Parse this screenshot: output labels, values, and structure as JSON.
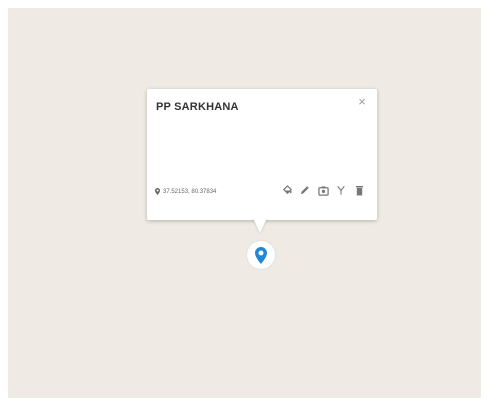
{
  "popup": {
    "title": "PP SARKHANA",
    "close_symbol": "×",
    "coordinates": "37.52153, 80.37834",
    "actions": [
      {
        "icon": "paint-bucket-icon"
      },
      {
        "icon": "pencil-icon"
      },
      {
        "icon": "camera-icon"
      },
      {
        "icon": "fork-icon"
      },
      {
        "icon": "trash-icon"
      }
    ]
  },
  "marker": {
    "icon": "location-pin-icon"
  },
  "colors": {
    "map_background": "#efebe4",
    "marker_accent": "#1f87d6",
    "icon_gray": "#777777"
  }
}
